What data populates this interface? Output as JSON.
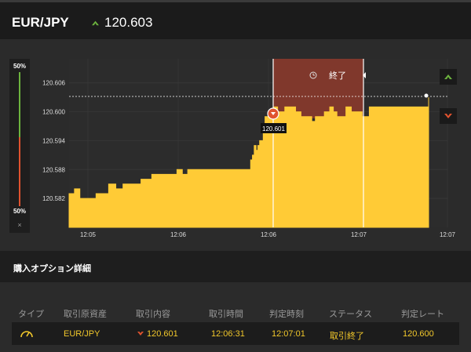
{
  "header": {
    "pair": "EUR/JPY",
    "rate": "120.603"
  },
  "meter": {
    "top_pct": "50%",
    "bottom_pct": "50%",
    "close_label": "×"
  },
  "chart_data": {
    "type": "area",
    "ylim": [
      120.576,
      120.611
    ],
    "y_ticks": [
      "120.606",
      "120.600",
      "120.594",
      "120.588",
      "120.582"
    ],
    "x_ticks": [
      "12:05",
      "12:06",
      "12:06",
      "12:07",
      "12:07"
    ],
    "entry_label": "120.601",
    "end_label": "終了",
    "reference_rate": 120.603,
    "series": [
      {
        "values": [
          [
            0,
            120.583
          ],
          [
            0.015,
            120.584
          ],
          [
            0.03,
            120.582
          ],
          [
            0.045,
            120.582
          ],
          [
            0.075,
            120.583
          ],
          [
            0.09,
            120.583
          ],
          [
            0.11,
            120.585
          ],
          [
            0.13,
            120.584
          ],
          [
            0.15,
            120.585
          ],
          [
            0.17,
            120.585
          ],
          [
            0.2,
            120.586
          ],
          [
            0.23,
            120.587
          ],
          [
            0.26,
            120.587
          ],
          [
            0.28,
            120.587
          ],
          [
            0.3,
            120.588
          ],
          [
            0.315,
            120.587
          ],
          [
            0.33,
            120.588
          ],
          [
            0.38,
            120.588
          ],
          [
            0.42,
            120.588
          ],
          [
            0.46,
            120.588
          ],
          [
            0.5,
            120.588
          ],
          [
            0.505,
            120.59
          ],
          [
            0.51,
            120.591
          ],
          [
            0.515,
            120.593
          ],
          [
            0.52,
            120.592
          ],
          [
            0.525,
            120.593
          ],
          [
            0.53,
            120.594
          ],
          [
            0.535,
            120.594
          ],
          [
            0.54,
            120.597
          ],
          [
            0.545,
            120.599
          ],
          [
            0.555,
            120.6
          ],
          [
            0.57,
            120.601
          ],
          [
            0.58,
            120.6
          ],
          [
            0.6,
            120.601
          ],
          [
            0.62,
            120.601
          ],
          [
            0.63,
            120.6
          ],
          [
            0.645,
            120.599
          ],
          [
            0.66,
            120.599
          ],
          [
            0.675,
            120.598
          ],
          [
            0.685,
            120.599
          ],
          [
            0.7,
            120.599
          ],
          [
            0.71,
            120.6
          ],
          [
            0.725,
            120.601
          ],
          [
            0.735,
            120.6
          ],
          [
            0.745,
            120.599
          ],
          [
            0.76,
            120.599
          ],
          [
            0.77,
            120.601
          ],
          [
            0.785,
            120.6
          ],
          [
            0.8,
            120.6
          ],
          [
            0.815,
            120.599
          ],
          [
            0.825,
            120.599
          ],
          [
            0.835,
            120.601
          ],
          [
            0.845,
            120.601
          ],
          [
            0.86,
            120.601
          ],
          [
            0.88,
            120.601
          ],
          [
            0.9,
            120.601
          ],
          [
            0.92,
            120.601
          ],
          [
            0.94,
            120.601
          ],
          [
            0.96,
            120.601
          ],
          [
            0.99,
            120.601
          ],
          [
            1.0,
            120.603
          ]
        ]
      }
    ]
  },
  "section": {
    "title": "購入オプション詳細"
  },
  "table": {
    "headers": [
      "タイプ",
      "取引原資産",
      "取引内容",
      "取引時間",
      "判定時刻",
      "ステータス",
      "判定レート"
    ],
    "row": {
      "asset": "EUR/JPY",
      "content": "120.601",
      "trade_time": "12:06:31",
      "judge_time": "12:07:01",
      "status": "取引終了",
      "judge_rate": "120.600"
    }
  },
  "colors": {
    "area": "#ffcb36",
    "buy": "#6cb33e",
    "sell": "#e0532f",
    "shade": "#8a3a2c"
  },
  "icons": [
    "up-arrow-icon",
    "down-arrow-icon",
    "clock-icon",
    "gauge-icon"
  ]
}
